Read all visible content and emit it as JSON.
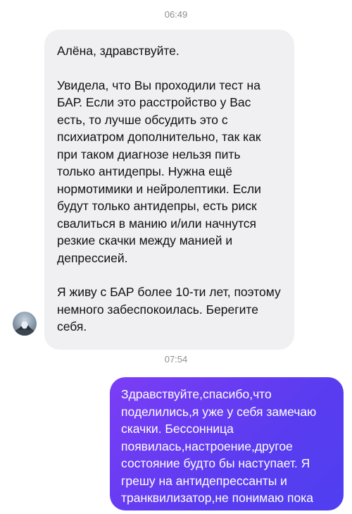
{
  "chat": {
    "time1": "06:49",
    "incoming": {
      "p1": "Алёна, здравствуйте.",
      "p2": "Увидела, что Вы проходили тест на БАР. Если это расстройство у Вас есть, то лучше обсудить это с психиатром дополнительно, так как при таком диагнозе нельзя пить только антидепры. Нужна ещё нормотимики и нейролептики. Если будут только антидепры, есть риск свалиться в манию и/или начнутся резкие скачки между манией и депрессией.",
      "p3": "Я живу с БАР более 10-ти лет, поэтому немного забеспокоилась. Берегите себя."
    },
    "time2": "07:54",
    "outgoing": {
      "text": "Здравствуйте,спасибо,что поделились,я уже у себя замечаю скачки. Бессонница появилась,настроение,другое состояние будто бы наступает. Я грешу на антидепрессанты и транквилизатор,не понимаю пока"
    }
  }
}
